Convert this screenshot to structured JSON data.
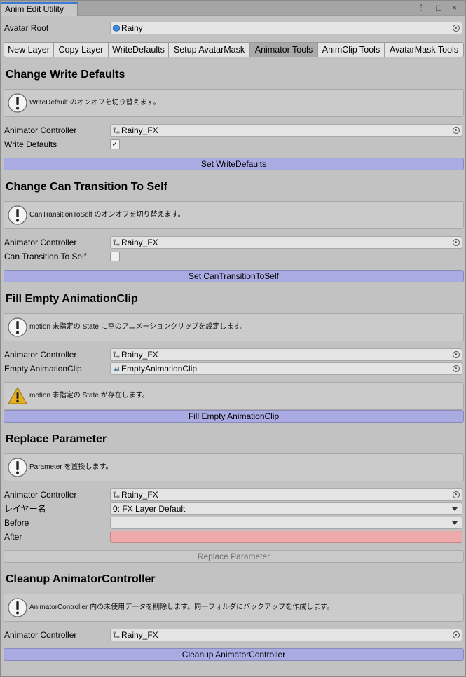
{
  "window": {
    "title": "Anim Edit Utility",
    "controls": "⋮ □ ×"
  },
  "avatar_root": {
    "label": "Avatar Root",
    "value": "Rainy"
  },
  "toolbar": [
    "New Layer",
    "Copy Layer",
    "WriteDefaults",
    "Setup AvatarMask",
    "Animator Tools",
    "AnimClip Tools",
    "AvatarMask Tools"
  ],
  "sections": {
    "write_defaults": {
      "heading": "Change Write Defaults",
      "help": "WriteDefault のオンオフを切り替えます。",
      "controller_label": "Animator Controller",
      "controller_value": "Rainy_FX",
      "toggle_label": "Write Defaults",
      "toggle_checked": true,
      "button": "Set WriteDefaults"
    },
    "transition_self": {
      "heading": "Change Can Transition To Self",
      "help": "CanTransitionToSelf のオンオフを切り替えます。",
      "controller_label": "Animator Controller",
      "controller_value": "Rainy_FX",
      "toggle_label": "Can Transition To Self",
      "toggle_checked": false,
      "button": "Set CanTransitionToSelf"
    },
    "fill_clip": {
      "heading": "Fill Empty AnimationClip",
      "help": "motion 未指定の State に空のアニメーションクリップを設定します。",
      "controller_label": "Animator Controller",
      "controller_value": "Rainy_FX",
      "clip_label": "Empty AnimationClip",
      "clip_value": "EmptyAnimationClip",
      "warning": "motion 未指定の State が存在します。",
      "button": "Fill Empty AnimationClip"
    },
    "replace_param": {
      "heading": "Replace Parameter",
      "help": "Parameter を置換します。",
      "controller_label": "Animator Controller",
      "controller_value": "Rainy_FX",
      "layer_label": "レイヤー名",
      "layer_value": "0: FX Layer Default",
      "before_label": "Before",
      "before_value": "",
      "after_label": "After",
      "after_value": "",
      "button": "Replace Parameter"
    },
    "cleanup": {
      "heading": "Cleanup AnimatorController",
      "help": "AnimatorController 内の未使用データを削除します。同一フォルダにバックアップを作成します。",
      "controller_label": "Animator Controller",
      "controller_value": "Rainy_FX",
      "button": "Cleanup AnimatorController"
    }
  },
  "colors": {
    "accent_button": "#ababe4",
    "error_field": "#eeaaaa",
    "panel_bg": "#c2c2c2"
  }
}
